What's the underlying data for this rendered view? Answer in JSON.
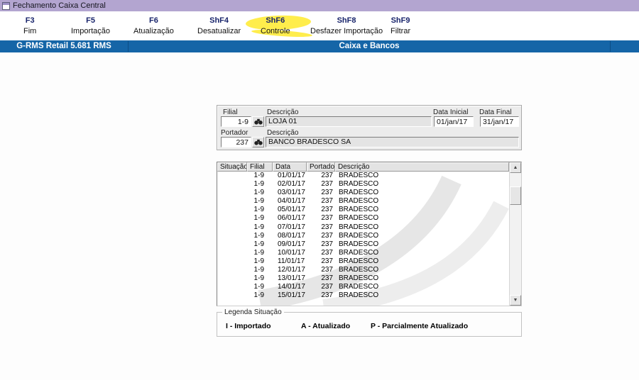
{
  "window": {
    "title": "Fechamento Caixa Central"
  },
  "toolbar": {
    "items": [
      {
        "key": "F3",
        "label": "Fim"
      },
      {
        "key": "F5",
        "label": "Importação"
      },
      {
        "key": "F6",
        "label": "Atualização"
      },
      {
        "key": "ShF4",
        "label": "Desatualizar"
      },
      {
        "key": "ShF6",
        "label": "Controle"
      },
      {
        "key": "ShF8",
        "label": "Desfazer Importação"
      },
      {
        "key": "ShF9",
        "label": "Filtrar"
      }
    ],
    "highlighted_key": "ShF6"
  },
  "infobar": {
    "left": "G-RMS Retail 5.681 RMS",
    "center": "Caixa e Bancos"
  },
  "filter": {
    "filial": {
      "label": "Filial",
      "value": "1-9"
    },
    "filial_descricao": {
      "label": "Descrição",
      "value": "LOJA 01"
    },
    "data_inicial": {
      "label": "Data Inicial",
      "value": "01/jan/17"
    },
    "data_final": {
      "label": "Data Final",
      "value": "31/jan/17"
    },
    "portador": {
      "label": "Portador",
      "value": "237"
    },
    "portador_descricao": {
      "label": "Descrição",
      "value": "BANCO BRADESCO SA"
    }
  },
  "grid": {
    "headers": [
      "Situação",
      "Filial",
      "Data",
      "Portador",
      "Descrição"
    ],
    "rows": [
      [
        "",
        "1-9",
        "01/01/17",
        "237",
        "BRADESCO"
      ],
      [
        "",
        "1-9",
        "02/01/17",
        "237",
        "BRADESCO"
      ],
      [
        "",
        "1-9",
        "03/01/17",
        "237",
        "BRADESCO"
      ],
      [
        "",
        "1-9",
        "04/01/17",
        "237",
        "BRADESCO"
      ],
      [
        "",
        "1-9",
        "05/01/17",
        "237",
        "BRADESCO"
      ],
      [
        "",
        "1-9",
        "06/01/17",
        "237",
        "BRADESCO"
      ],
      [
        "",
        "1-9",
        "07/01/17",
        "237",
        "BRADESCO"
      ],
      [
        "",
        "1-9",
        "08/01/17",
        "237",
        "BRADESCO"
      ],
      [
        "",
        "1-9",
        "09/01/17",
        "237",
        "BRADESCO"
      ],
      [
        "",
        "1-9",
        "10/01/17",
        "237",
        "BRADESCO"
      ],
      [
        "",
        "1-9",
        "11/01/17",
        "237",
        "BRADESCO"
      ],
      [
        "",
        "1-9",
        "12/01/17",
        "237",
        "BRADESCO"
      ],
      [
        "",
        "1-9",
        "13/01/17",
        "237",
        "BRADESCO"
      ],
      [
        "",
        "1-9",
        "14/01/17",
        "237",
        "BRADESCO"
      ],
      [
        "",
        "1-9",
        "15/01/17",
        "237",
        "BRADESCO"
      ]
    ]
  },
  "legend": {
    "title": "Legenda Situação",
    "items": [
      "I - Importado",
      "A - Atualizado",
      "P - Parcialmente Atualizado"
    ]
  },
  "colors": {
    "titlebar": "#b3a5d0",
    "infobar": "#1565a7",
    "highlight": "#ffe81a",
    "key_text": "#18246b"
  }
}
